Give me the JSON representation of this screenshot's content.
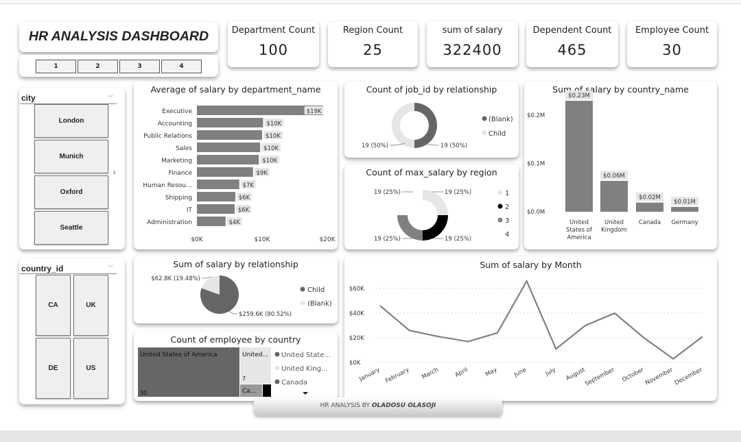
{
  "dashboard": {
    "title": "HR ANALYSIS DASHBOARD",
    "pages": [
      "1",
      "2",
      "3",
      "4"
    ],
    "footer_prefix": "HR ANALYSIS BY ",
    "footer_author": "OLADOSU OLASOJI"
  },
  "kpis": [
    {
      "label": "Department Count",
      "value": "100"
    },
    {
      "label": "Region Count",
      "value": "25"
    },
    {
      "label": "sum of salary",
      "value": "322400"
    },
    {
      "label": "Dependent Count",
      "value": "465"
    },
    {
      "label": "Employee Count",
      "value": "30"
    }
  ],
  "slicers": {
    "city": {
      "title": "city",
      "items": [
        "London",
        "Munich",
        "Oxford",
        "Seattle"
      ]
    },
    "country": {
      "title": "country_id",
      "items": [
        "CA",
        "UK",
        "DE",
        "US"
      ]
    }
  },
  "icons": {
    "dropdown": "chevron-down-icon",
    "next": "chevron-right-icon",
    "more": "caret-down-icon"
  },
  "colors": {
    "bar": "#808080",
    "dark": "#666666",
    "black": "#000000",
    "light": "#e6e6e6",
    "mid": "#999999"
  },
  "chart_data": [
    {
      "id": "dept",
      "type": "bar",
      "title": "Average of salary by department_name",
      "categories": [
        "Executive",
        "Accounting",
        "Public Relations",
        "Sales",
        "Marketing",
        "Finance",
        "Human Resou…",
        "Shipping",
        "IT",
        "Administration"
      ],
      "values": [
        19333,
        10150,
        10000,
        9700,
        9500,
        8600,
        6500,
        5900,
        5800,
        4400
      ],
      "data_labels": [
        "$19K",
        "$10K",
        "$10K",
        "$10K",
        "$10K",
        "$9K",
        "$7K",
        "$6K",
        "$6K",
        "$4K"
      ],
      "x_ticks": [
        "$0K",
        "$10K",
        "$20K"
      ],
      "xlim": [
        0,
        20000
      ]
    },
    {
      "id": "job",
      "type": "pie",
      "title": "Count of job_id by relationship",
      "labels": [
        "(Blank)",
        "Child"
      ],
      "values": [
        19,
        19
      ],
      "data_labels": [
        "19 (50%)",
        "19 (50%)"
      ],
      "colors": [
        "#666666",
        "#e6e6e6"
      ]
    },
    {
      "id": "region",
      "type": "pie",
      "title": "Count of max_salary by region",
      "labels": [
        "1",
        "2",
        "3",
        "4"
      ],
      "values": [
        19,
        19,
        19,
        19
      ],
      "data_labels": [
        "19 (25%)",
        "19 (25%)",
        "19 (25%)",
        "19 (25%)"
      ],
      "colors": [
        "#e6e6e6",
        "#000000",
        "#808080",
        "#ffffff"
      ]
    },
    {
      "id": "country",
      "type": "bar",
      "title": "Sum of salary by country_name",
      "categories": [
        "United States of America",
        "United Kingdom",
        "Canada",
        "Germany"
      ],
      "category_lines": [
        [
          "United",
          "States of",
          "America"
        ],
        [
          "United",
          "Kingdom"
        ],
        [
          "Canada"
        ],
        [
          "Germany"
        ]
      ],
      "values": [
        230000,
        64000,
        19000,
        10000
      ],
      "data_labels": [
        "$0.23M",
        "$0.06M",
        "$0.02M",
        "$0.01M"
      ],
      "y_ticks": [
        "$0.0M",
        "$0.1M",
        "$0.2M"
      ],
      "ylim": [
        0,
        250000
      ]
    },
    {
      "id": "relationship",
      "type": "pie",
      "title": "Sum of salary by relationship",
      "labels": [
        "Child",
        "(Blank)"
      ],
      "values": [
        259.6,
        62.8
      ],
      "data_labels": [
        "$259.6K (80.52%)",
        "$62.8K (19.48%)"
      ],
      "colors": [
        "#666666",
        "#e6e6e6"
      ]
    },
    {
      "id": "month",
      "type": "line",
      "title": "Sum of salary by Month",
      "x": [
        "January",
        "February",
        "March",
        "April",
        "May",
        "June",
        "July",
        "August",
        "September",
        "October",
        "November",
        "December"
      ],
      "values": [
        46000,
        26000,
        21000,
        17000,
        24000,
        66000,
        11000,
        30000,
        40000,
        20000,
        3000,
        21000
      ],
      "y_ticks": [
        "$0K",
        "$20K",
        "$40K",
        "$60K"
      ],
      "ylim": [
        0,
        70000
      ]
    },
    {
      "id": "treemap",
      "type": "table",
      "title": "Count of employee by country",
      "items": [
        {
          "name": "United States of America",
          "short": "United States of America",
          "value": "30"
        },
        {
          "name": "United Kingdom",
          "short": "United...",
          "value": "7"
        },
        {
          "name": "Canada",
          "short": "Ca...",
          "value": ""
        }
      ],
      "legend": [
        "United State...",
        "United King...",
        "Canada"
      ]
    }
  ]
}
